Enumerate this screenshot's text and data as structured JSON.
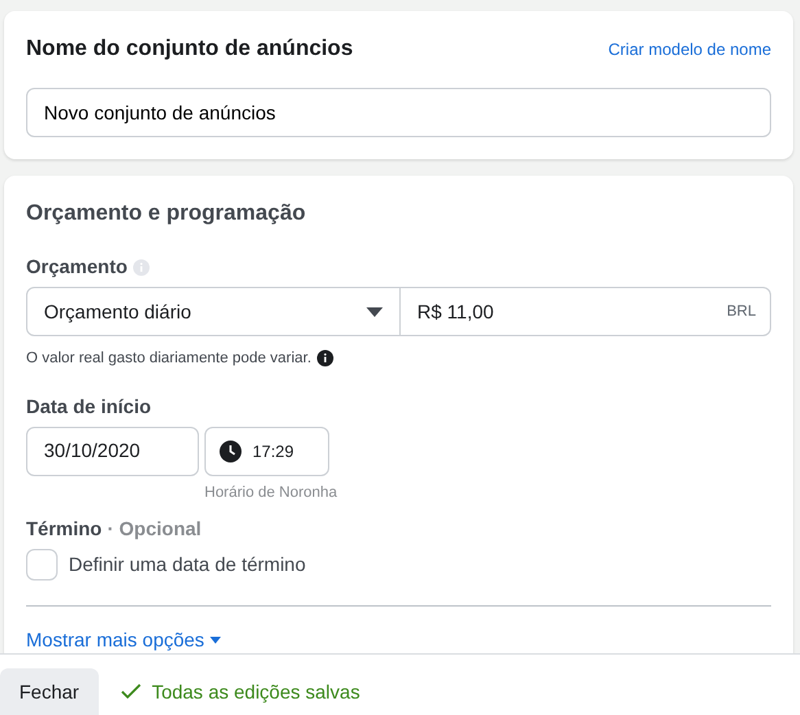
{
  "name_card": {
    "title": "Nome do conjunto de anúncios",
    "link": "Criar modelo de nome",
    "value": "Novo conjunto de anúncios"
  },
  "budget_card": {
    "title": "Orçamento e programação",
    "budget_label": "Orçamento",
    "budget_type": "Orçamento diário",
    "amount": "R$ 11,00",
    "currency": "BRL",
    "hint": "O valor real gasto diariamente pode variar.",
    "start_label": "Data de início",
    "date": "30/10/2020",
    "time": "17:29",
    "timezone": "Horário de Noronha",
    "end_label": "Término",
    "end_optional": "· Opcional",
    "end_checkbox": {
      "label": "Definir uma data de término",
      "checked": false
    },
    "more_link": "Mostrar mais opções"
  },
  "footer": {
    "close_button": "Fechar",
    "status": "Todas as edições salvas"
  }
}
